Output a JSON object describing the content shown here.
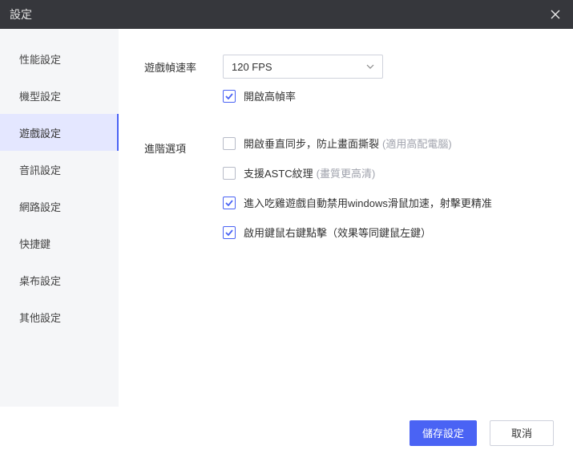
{
  "title": "設定",
  "sidebar": {
    "items": [
      {
        "label": "性能設定"
      },
      {
        "label": "機型設定"
      },
      {
        "label": "遊戲設定"
      },
      {
        "label": "音訊設定"
      },
      {
        "label": "網路設定"
      },
      {
        "label": "快捷鍵"
      },
      {
        "label": "桌布設定"
      },
      {
        "label": "其他設定"
      }
    ],
    "activeIndex": 2
  },
  "labels": {
    "fps": "遊戲幀速率",
    "advanced": "進階選項"
  },
  "fps": {
    "value": "120 FPS"
  },
  "checks": {
    "highfps": {
      "label": "開啟高幀率",
      "checked": true
    },
    "vsync": {
      "label": "開啟垂直同步，防止畫面撕裂",
      "hint": "(適用高配電腦)",
      "checked": false
    },
    "astc": {
      "label": "支援ASTC紋理",
      "hint": "(畫質更高清)",
      "checked": false
    },
    "mouse": {
      "label": "進入吃雞遊戲自動禁用windows滑鼠加速，射擊更精准",
      "checked": true
    },
    "rclick": {
      "label": "啟用鍵鼠右鍵點擊（效果等同鍵鼠左鍵）",
      "checked": true
    }
  },
  "buttons": {
    "save": "儲存設定",
    "cancel": "取消"
  }
}
